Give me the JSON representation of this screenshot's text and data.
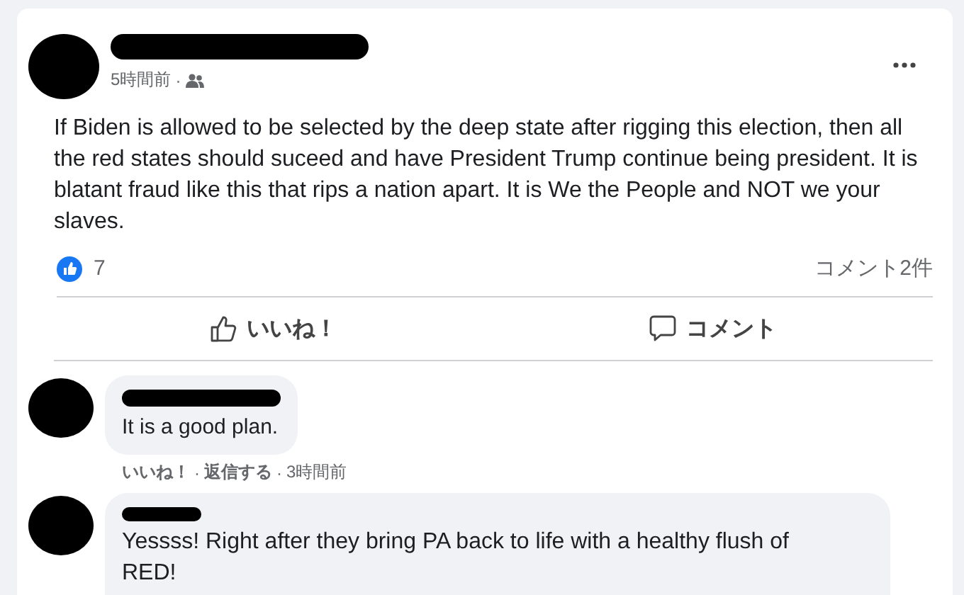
{
  "post": {
    "time": "5時間前",
    "separator": "·",
    "text": "If Biden is allowed to be selected by the deep state after rigging this election, then all the red states should suceed and have President Trump continue being president. It is blatant fraud like this that rips a nation apart. It is We the People and NOT we your slaves.",
    "like_count": "7",
    "comment_count": "コメント2件"
  },
  "actions": [
    {
      "kind": "like",
      "label": "いいね！"
    },
    {
      "kind": "comment",
      "label": "コメント"
    }
  ],
  "comments": [
    {
      "text": "It is a good plan.",
      "links": [
        {
          "label": "いいね！"
        },
        {
          "label": "返信する"
        }
      ],
      "separator": "·",
      "time": "3時間前"
    },
    {
      "text": "Yessss! Right after they bring PA back to life with a healthy flush of RED!"
    }
  ]
}
